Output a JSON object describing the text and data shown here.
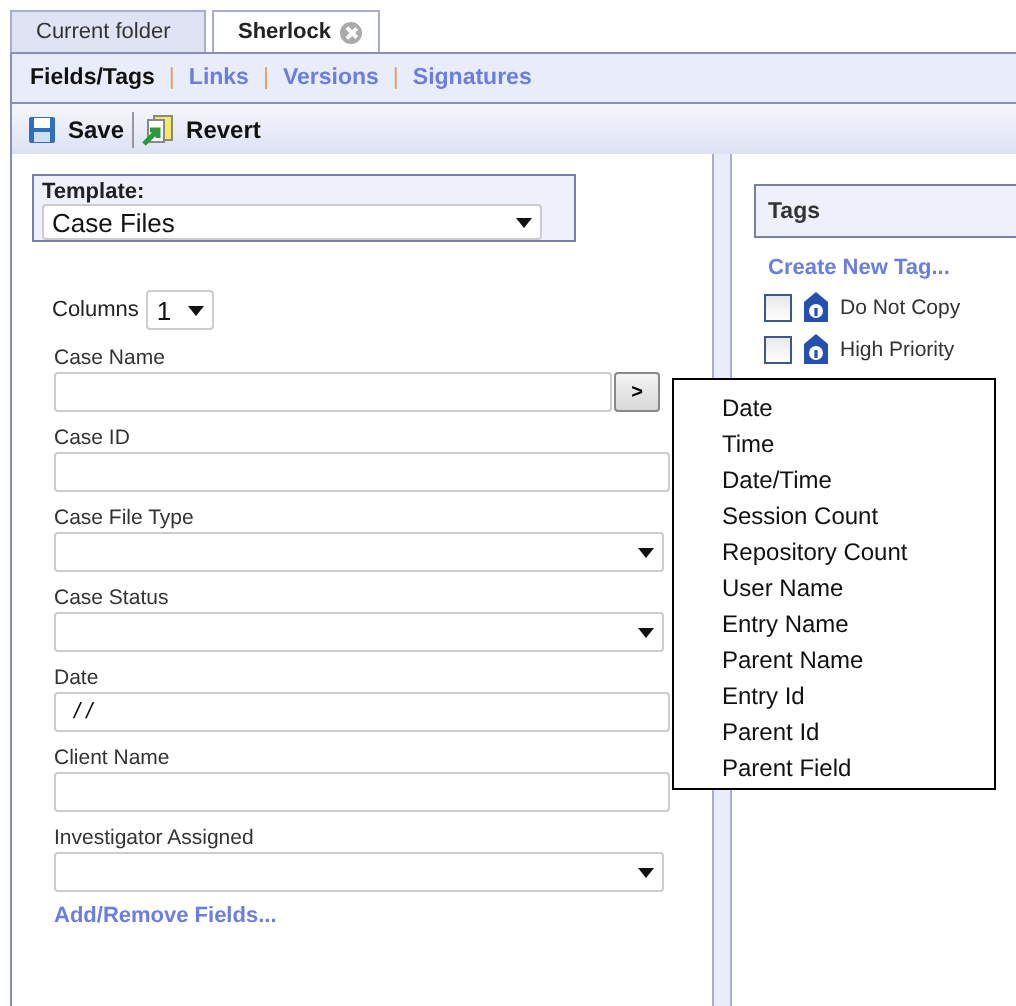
{
  "tabs": [
    {
      "label": "Current folder",
      "selected": false,
      "closable": false
    },
    {
      "label": "Sherlock",
      "selected": true,
      "closable": true
    }
  ],
  "subtab_separator": "|",
  "subtabs": [
    {
      "label": "Fields/Tags",
      "selected": true
    },
    {
      "label": "Links",
      "selected": false
    },
    {
      "label": "Versions",
      "selected": false
    },
    {
      "label": "Signatures",
      "selected": false
    }
  ],
  "toolbar": [
    {
      "label": "Save",
      "kind": "save"
    },
    {
      "label": "Revert",
      "kind": "revert"
    }
  ],
  "template": {
    "label": "Template:",
    "value": "Case Files"
  },
  "columns": {
    "label": "Columns",
    "value": "1"
  },
  "fields": [
    {
      "label": "Case Name",
      "kind": "text-button",
      "button": ">"
    },
    {
      "label": "Case ID",
      "kind": "text"
    },
    {
      "label": "Case File Type",
      "kind": "select"
    },
    {
      "label": "Case Status",
      "kind": "select"
    },
    {
      "label": "Date",
      "kind": "text",
      "value": " / /"
    },
    {
      "label": "Client Name",
      "kind": "text"
    },
    {
      "label": "Investigator Assigned",
      "kind": "select"
    }
  ],
  "add_remove_link": "Add/Remove Fields...",
  "tags_panel": {
    "title": "Tags",
    "create_link": "Create New Tag...",
    "tags": [
      {
        "label": "Do Not Copy",
        "checked": false
      },
      {
        "label": "High Priority",
        "checked": false
      }
    ]
  },
  "popup_menu": [
    "Date",
    "Time",
    "Date/Time",
    "Session Count",
    "Repository Count",
    "User Name",
    "Entry Name",
    "Parent Name",
    "Entry Id",
    "Parent Id",
    "Parent Field"
  ]
}
